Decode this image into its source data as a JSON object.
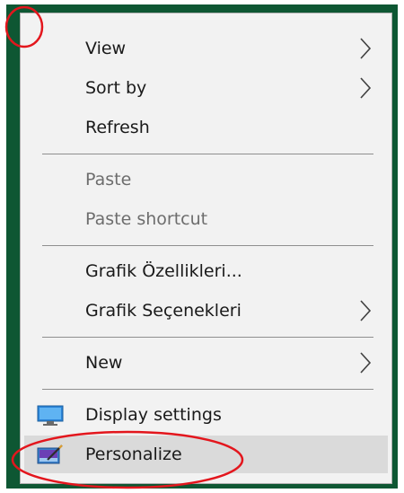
{
  "menu": {
    "items": [
      {
        "label": "View",
        "submenu": true,
        "enabled": true
      },
      {
        "label": "Sort by",
        "submenu": true,
        "enabled": true
      },
      {
        "label": "Refresh",
        "submenu": false,
        "enabled": true
      },
      {
        "label": "Paste",
        "submenu": false,
        "enabled": false
      },
      {
        "label": "Paste shortcut",
        "submenu": false,
        "enabled": false
      },
      {
        "label": "Grafik Özellikleri...",
        "submenu": false,
        "enabled": true
      },
      {
        "label": "Grafik Seçenekleri",
        "submenu": true,
        "enabled": true
      },
      {
        "label": "New",
        "submenu": true,
        "enabled": true
      },
      {
        "label": "Display settings",
        "submenu": false,
        "enabled": true,
        "icon": "display-settings-icon"
      },
      {
        "label": "Personalize",
        "submenu": false,
        "enabled": true,
        "icon": "personalize-icon",
        "highlighted": true
      }
    ]
  },
  "colors": {
    "desktop_background": "#0e5733",
    "menu_background": "#f2f2f2",
    "highlight": "#dadada",
    "annotation_red": "#e3161d"
  },
  "annotations": [
    {
      "shape": "circle",
      "target": "top-left-corner"
    },
    {
      "shape": "ellipse",
      "target": "personalize-item"
    }
  ]
}
